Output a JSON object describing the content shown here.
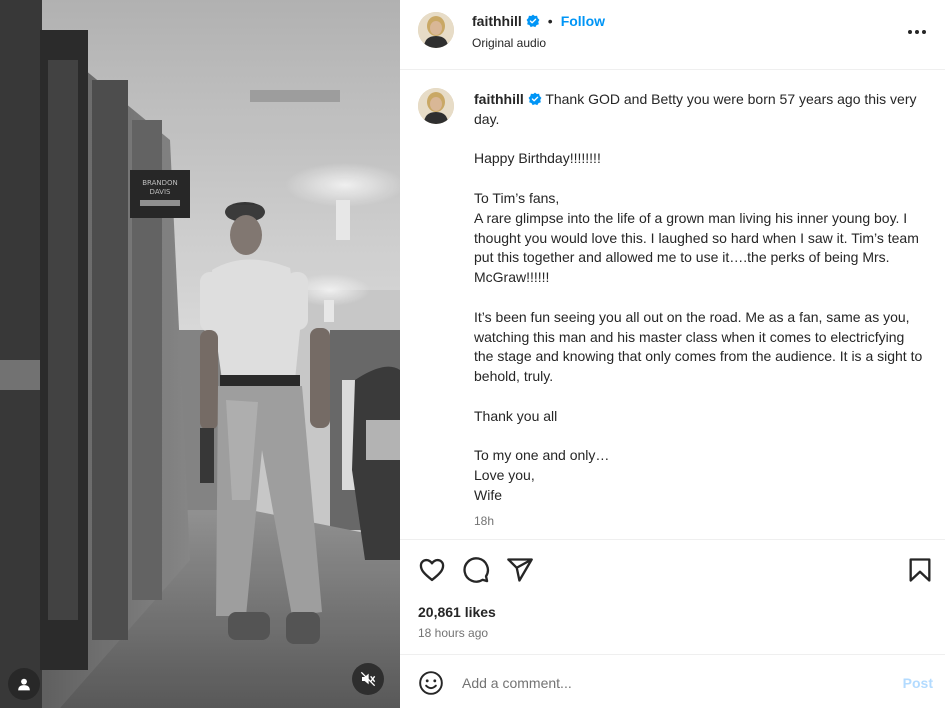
{
  "post": {
    "author": "faithhill",
    "follow_label": "Follow",
    "separator": "•",
    "audio_label": "Original audio",
    "caption_text": "Thank GOD and Betty you were born 57 years ago this very day.\n\nHappy Birthday!!!!!!!!\n\nTo Tim’s fans,\nA rare glimpse into the life of a grown man living his inner young boy. I thought you would love this. I laughed so hard when I saw it. Tim’s team put this together and allowed me to use it….the perks of being Mrs. McGraw!!!!!!\n\nIt’s been fun seeing you all out on the road. Me as a fan, same as you, watching this man and his master class when it comes to electricfying the stage and knowing that only comes from the audience. It is a sight to behold, truly.\n\nThank you all\n\nTo my one and only…\nLove you,\nWife",
    "caption_time": "18h",
    "likes": "20,861 likes",
    "posted_ago": "18 hours ago"
  },
  "media": {
    "door_sign_line1": "BRANDON",
    "door_sign_line2": "DAVIS"
  },
  "comment": {
    "placeholder": "Add a comment...",
    "post_label": "Post"
  },
  "icons": {
    "like": "heart-icon",
    "comment": "comment-icon",
    "share": "share-icon",
    "save": "bookmark-icon",
    "more": "more-icon",
    "emoji": "emoji-icon",
    "tags": "user-tag-icon",
    "mute": "muted-speaker-icon",
    "verified": "verified-badge-icon"
  },
  "colors": {
    "accent": "#0095f6",
    "verified": "#0095f6",
    "post_disabled": "#b3dbff",
    "muted_text": "#737373"
  }
}
